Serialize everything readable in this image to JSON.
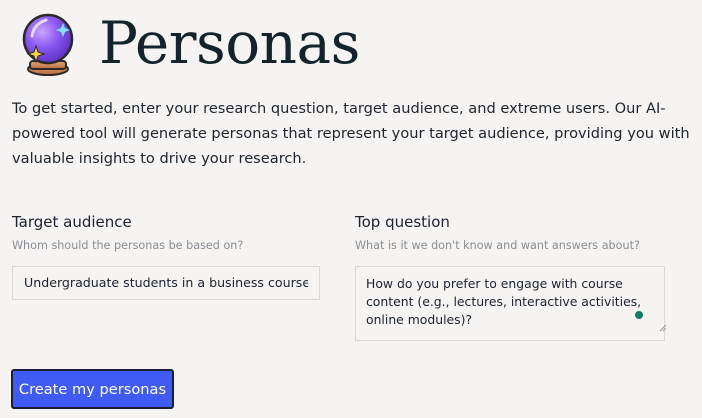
{
  "header": {
    "logo_icon": "crystal-ball-icon",
    "title": "Personas"
  },
  "intro": {
    "text": "To get started, enter your research question, target audience, and extreme users. Our AI-powered tool will generate personas that represent your target audience, providing you with valuable insights to drive your research."
  },
  "form": {
    "audience": {
      "label": "Target audience",
      "help": "Whom should the personas be based on?",
      "value": "Undergraduate students in a business course"
    },
    "question": {
      "label": "Top question",
      "help": "What is it we don't know and want answers about?",
      "value": "How do you prefer to engage with course content (e.g., lectures, interactive activities, online modules)?"
    },
    "submit_label": "Create my personas"
  },
  "colors": {
    "background": "#f5f4f2",
    "button": "#3f5bf4",
    "button_border": "#1a1f36",
    "title": "#13252a",
    "help_text": "#8a8d93",
    "status_dot": "#0f7e64"
  }
}
